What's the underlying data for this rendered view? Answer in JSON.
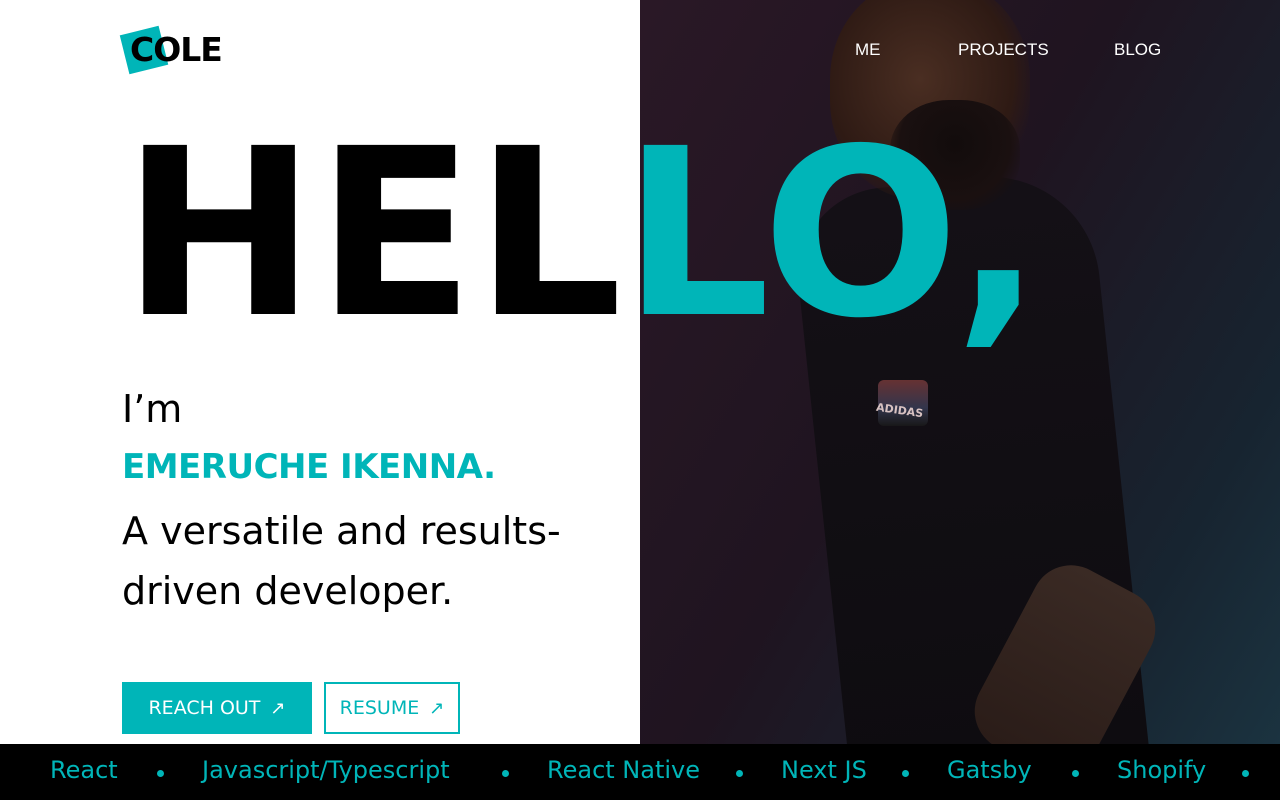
{
  "brand": {
    "logo_text": "COLE"
  },
  "nav": {
    "items": [
      "ME",
      "PROJECTS",
      "BLOG"
    ]
  },
  "hero": {
    "headline_dark": "HEL",
    "headline_accent": "LO,",
    "greeting": "I’m",
    "name": "EMERUCHE IKENNA.",
    "tagline": "A versatile and results-driven developer."
  },
  "actions": {
    "reach_out_label": "REACH OUT",
    "resume_label": "RESUME",
    "arrow_icon": "arrow-up-right-icon"
  },
  "photo": {
    "shirt_print": "ADIDAS"
  },
  "ticker": {
    "items": [
      "React",
      "Javascript/Typescript",
      "React Native",
      "Next JS",
      "Gatsby",
      "Shopify"
    ]
  },
  "colors": {
    "accent": "#00b5b8",
    "text": "#000000",
    "background": "#ffffff",
    "ticker_bg": "#000000"
  }
}
